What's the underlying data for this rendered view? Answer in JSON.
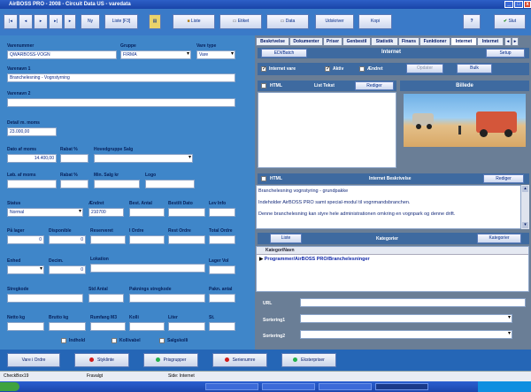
{
  "window": {
    "title": "AirBOSS PRO - 2008 - Circuit Data US - varedata"
  },
  "toolbar": {
    "nav_first": "|◂",
    "nav_prev": "◂",
    "nav_next": "▸",
    "nav_last": "▸|",
    "nav_extra": "▸",
    "ny": "Ny",
    "liste_f3": "Liste [F3]",
    "liste": "Liste",
    "etiket": "Etiket",
    "data": "Data",
    "udskriver": "Udskriver",
    "kopi": "Kopi",
    "help": "?",
    "slut": "Slut"
  },
  "form": {
    "varenummer_label": "Varenummer",
    "varenummer": "QWARBOSS-VOGN",
    "gruppe_label": "Gruppe",
    "gruppe": "FIRMA",
    "varetype_label": "Vare type",
    "varetype": "Vare",
    "varenavn1_label": "Varenavn 1",
    "varenavn1": "Branchelesning - Vognstyrning",
    "varenavn2_label": "Varenavn 2",
    "detail_label": "Detail m. moms",
    "detail": "23.000,00",
    "dato_label": "Dato af moms",
    "dato": "14.400,00",
    "rabat_label": "Rabat %",
    "hovedgruppe_label": "Hovedgruppe Salg",
    "kostpris_label": "Løb. af moms",
    "rabat2_label": "Rabat %",
    "min_label": "Min. Salg kr",
    "logo_label": "Logo",
    "status_label": "Status",
    "status": "Normal",
    "aendret_label": "Ændret",
    "aendret": "210700",
    "bestilt_label": "Best. Antal",
    "bestilt_dato_label": "Bestilt Dato",
    "levinfo_label": "Lev Info",
    "paalager_label": "På lager",
    "paalager": "0",
    "disponible_label": "Disponible",
    "disponible": "0",
    "reserveret_label": "Reserveret",
    "iordre_label": "I Ordre",
    "rest_label": "Rest Ordre",
    "total_label": "Total Ordre",
    "enhed_label": "Enhed",
    "decim_label": "Decim.",
    "decim": "0",
    "lokation_label": "Lokation",
    "lager_label": "Lager Vol",
    "stregkode_label": "Stregkode",
    "std_label": "Std Antal",
    "pakning_label": "Paknings stregkode",
    "pakantal_label": "Pakn. antal",
    "netto_label": "Netto kg",
    "brutto_label": "Brutto kg",
    "rumfang_label": "Rumfang M3",
    "kolli_label": "Kolli",
    "liter_label": "Liter",
    "st_label": "St.",
    "indhold_label": "Indhold",
    "kollivabel_label": "Kollivabel",
    "salgskolli_label": "Salgskolli"
  },
  "tabs": [
    "Beskrivelse",
    "Dokumenter",
    "Priser",
    "Genbestil",
    "Statistik",
    "Finans",
    "Funktioner",
    "Internet",
    "Internet"
  ],
  "internet": {
    "edi_btn": "EDI/Batch",
    "internet_header": "Internet",
    "setup_btn": "Setup",
    "internet_vare": "Internet vare",
    "aktiv": "Aktiv",
    "aendret": "Ændret",
    "opdater": "Opdater",
    "bulk": "Bulk",
    "html": "HTML",
    "listtekst": "List Tekst",
    "rediger": "Rediger",
    "billede": "Billede",
    "html2": "HTML",
    "internet_beskrivelse": "Internet Beskrivelse",
    "rediger2": "Rediger",
    "desc_lines": [
      "Branchelesning vognstyring - grundpakke",
      "Indeholder AirBOSS PRO samt special-modul til vognmandsbranchen.",
      "Denne branchelesning kan styre hele administrationen omkring en vognpark og denne drift."
    ],
    "liste_btn": "Liste",
    "kategorier_header": "Kategorier",
    "kategorier_btn": "Kategorier",
    "kategori_col": "KategoriNavn",
    "kategori_row": "Programmer/AirBOSS PRO/Branchelesninger",
    "url_label": "URL",
    "sort1_label": "Sortering1",
    "sort2_label": "Sortering2"
  },
  "bottom": {
    "vare_ordre": "Vare i Ordre",
    "styklinte": "Styklinte",
    "prisgrupper": "Prisgrupper",
    "serienumre": "Serienumre",
    "eksterpriser": "Eksterpriser",
    "dot_red": "#d11c1c",
    "dot_green": "#22b14c"
  },
  "status": {
    "left": "CheckBox19",
    "middle": "Fravalgt",
    "right": "Side: Internet"
  }
}
